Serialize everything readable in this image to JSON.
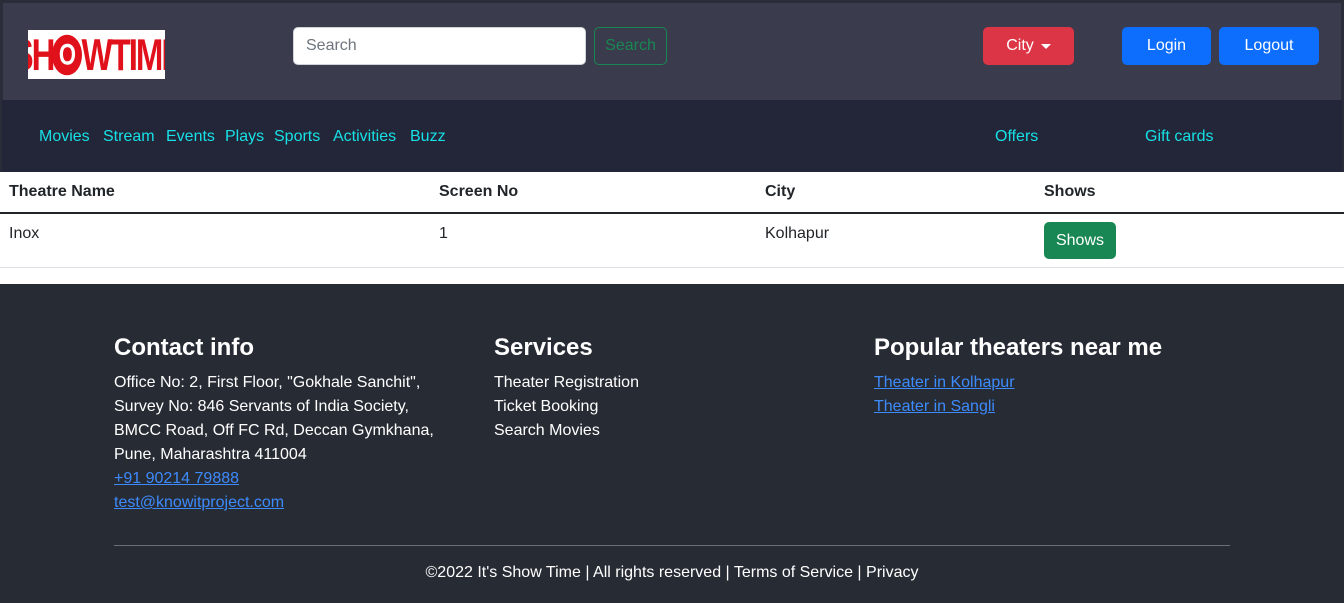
{
  "header": {
    "logo_text": "SHOWTIME",
    "search_placeholder": "Search",
    "search_button": "Search",
    "city_button": "City",
    "login_button": "Login",
    "logout_button": "Logout"
  },
  "nav": {
    "items": [
      "Movies",
      "Stream",
      "Events",
      "Plays",
      "Sports",
      "Activities",
      "Buzz"
    ],
    "offers": "Offers",
    "gift_cards": "Gift cards"
  },
  "table": {
    "headers": [
      "Theatre Name",
      "Screen No",
      "City",
      "Shows"
    ],
    "rows": [
      {
        "theatre_name": "Inox",
        "screen_no": "1",
        "city": "Kolhapur",
        "shows_button": "Shows"
      }
    ]
  },
  "footer": {
    "contact": {
      "heading": "Contact info",
      "address_lines": [
        "Office No: 2, First Floor, \"Gokhale Sanchit\",",
        "Survey No: 846 Servants of India Society,",
        "BMCC Road, Off FC Rd, Deccan Gymkhana,",
        "Pune, Maharashtra 411004"
      ],
      "phone": "+91 90214 79888",
      "email": "test@knowitproject.com"
    },
    "services": {
      "heading": "Services",
      "items": [
        "Theater Registration",
        "Ticket Booking",
        "Search Movies"
      ]
    },
    "popular": {
      "heading": "Popular theaters near me",
      "links": [
        "Theater in Kolhapur",
        "Theater in Sangli"
      ]
    },
    "copyright": "©2022 It's Show Time | All rights reserved | Terms of Service | Privacy"
  },
  "colors": {
    "topbar": "#3a3b4c",
    "navbar": "#222638",
    "nav_link": "#17e0e6",
    "danger": "#dc3545",
    "primary": "#0d6efd",
    "success": "#198754",
    "footer": "#272b34",
    "footer_link": "#3d8bfd"
  }
}
